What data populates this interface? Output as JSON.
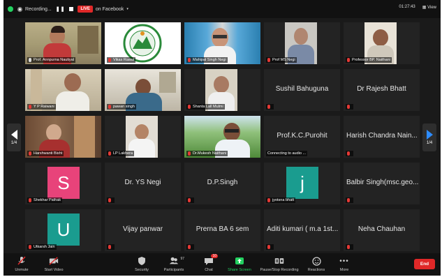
{
  "topbar": {
    "recording_label": "Recording...",
    "live_label": "LIVE",
    "stream_target": "on Facebook",
    "clock": "01:27:43",
    "view_label": "View"
  },
  "navigation": {
    "left_page": "1/4",
    "right_page": "1/4"
  },
  "participants": [
    {
      "name": "Prof. Annpurna Nautiyal",
      "kind": "video",
      "active": true,
      "mic": "on"
    },
    {
      "name": "Vikas Rawat",
      "kind": "logo"
    },
    {
      "name": "Mahipal Singh Negi",
      "kind": "video"
    },
    {
      "name": "Prof MS Negi",
      "kind": "video"
    },
    {
      "name": "Professor BP. Naithani",
      "kind": "video"
    },
    {
      "name": "Y P Raiwani",
      "kind": "video"
    },
    {
      "name": "pawan singh",
      "kind": "video"
    },
    {
      "name": "Shanta Lall Mulmi",
      "kind": "video"
    },
    {
      "name": "Sushil Bahuguna",
      "kind": "name"
    },
    {
      "name": "Dr Rajesh Bhatt",
      "kind": "name"
    },
    {
      "name": "Harshwanti Bisht",
      "kind": "video"
    },
    {
      "name": "LP Lakhera",
      "kind": "video"
    },
    {
      "name": "Dr.Mukesh Naithani",
      "kind": "video"
    },
    {
      "name": "Prof.K.C.Purohit",
      "kind": "name",
      "label": "Connecting to audio ..."
    },
    {
      "name": "Harish Chandra Nain...",
      "kind": "name"
    },
    {
      "name": "Shekhar Pathak",
      "kind": "avatar",
      "letter": "S",
      "color": "#e8437a"
    },
    {
      "name": "Dr. YS Negi",
      "kind": "name"
    },
    {
      "name": "D.P.Singh",
      "kind": "name"
    },
    {
      "name": "jyotsna bhatt",
      "kind": "avatar",
      "letter": "j",
      "color": "#1a9c8f"
    },
    {
      "name": "Balbir Singh(msc.geo...",
      "kind": "name"
    },
    {
      "name": "Utkarsh Jain",
      "kind": "avatar",
      "letter": "U",
      "color": "#1a9c8f"
    },
    {
      "name": "Vijay panwar",
      "kind": "name"
    },
    {
      "name": "Prerna BA 6 sem",
      "kind": "name"
    },
    {
      "name": "Aditi kumari ( m.a 1st...",
      "kind": "name"
    },
    {
      "name": "Neha Chauhan",
      "kind": "name"
    }
  ],
  "toolbar": {
    "unmute": "Unmute",
    "start_video": "Start Video",
    "security": "Security",
    "participants": "Participants",
    "participants_count": "97",
    "chat": "Chat",
    "chat_badge": "10",
    "share_screen": "Share Screen",
    "pause_stop": "Pause/Stop Recording",
    "reactions": "Reactions",
    "more": "More",
    "end": "End"
  },
  "colors": {
    "accent_green": "#23d160",
    "share_green": "#23d160",
    "live_red": "#e02828",
    "active_speaker": "#b7e32a"
  }
}
